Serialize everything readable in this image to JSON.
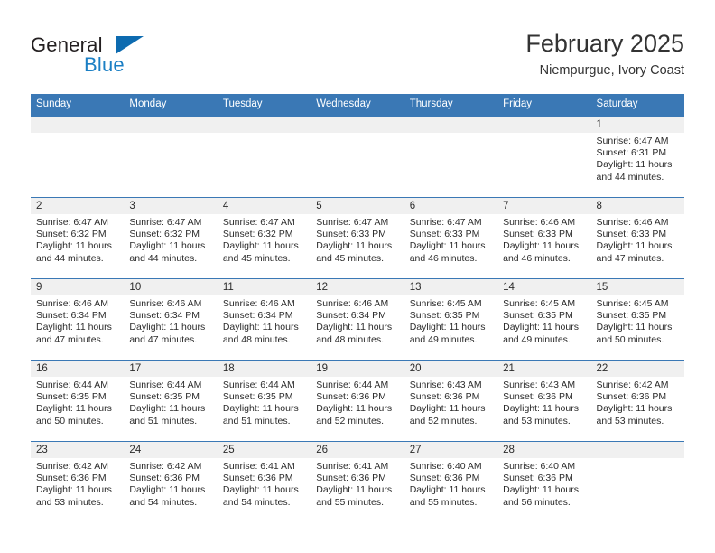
{
  "brand": {
    "name_part1": "General",
    "name_part2": "Blue",
    "triangle_icon": "triangle-icon",
    "accent_color": "#0d6bb0",
    "blue_text_color": "#1b7fc4"
  },
  "header": {
    "title": "February 2025",
    "subtitle": "Niempurgue, Ivory Coast"
  },
  "calendar": {
    "header_bg": "#3a78b5",
    "daynum_bg": "#f0f0f0",
    "weekday_headers": [
      "Sunday",
      "Monday",
      "Tuesday",
      "Wednesday",
      "Thursday",
      "Friday",
      "Saturday"
    ],
    "weeks": [
      [
        {
          "day": "",
          "sunrise": "",
          "sunset": "",
          "daylight_line1": "",
          "daylight_line2": "",
          "empty": true
        },
        {
          "day": "",
          "sunrise": "",
          "sunset": "",
          "daylight_line1": "",
          "daylight_line2": "",
          "empty": true
        },
        {
          "day": "",
          "sunrise": "",
          "sunset": "",
          "daylight_line1": "",
          "daylight_line2": "",
          "empty": true
        },
        {
          "day": "",
          "sunrise": "",
          "sunset": "",
          "daylight_line1": "",
          "daylight_line2": "",
          "empty": true
        },
        {
          "day": "",
          "sunrise": "",
          "sunset": "",
          "daylight_line1": "",
          "daylight_line2": "",
          "empty": true
        },
        {
          "day": "",
          "sunrise": "",
          "sunset": "",
          "daylight_line1": "",
          "daylight_line2": "",
          "empty": true
        },
        {
          "day": "1",
          "sunrise": "Sunrise: 6:47 AM",
          "sunset": "Sunset: 6:31 PM",
          "daylight_line1": "Daylight: 11 hours",
          "daylight_line2": "and 44 minutes.",
          "empty": false
        }
      ],
      [
        {
          "day": "2",
          "sunrise": "Sunrise: 6:47 AM",
          "sunset": "Sunset: 6:32 PM",
          "daylight_line1": "Daylight: 11 hours",
          "daylight_line2": "and 44 minutes.",
          "empty": false
        },
        {
          "day": "3",
          "sunrise": "Sunrise: 6:47 AM",
          "sunset": "Sunset: 6:32 PM",
          "daylight_line1": "Daylight: 11 hours",
          "daylight_line2": "and 44 minutes.",
          "empty": false
        },
        {
          "day": "4",
          "sunrise": "Sunrise: 6:47 AM",
          "sunset": "Sunset: 6:32 PM",
          "daylight_line1": "Daylight: 11 hours",
          "daylight_line2": "and 45 minutes.",
          "empty": false
        },
        {
          "day": "5",
          "sunrise": "Sunrise: 6:47 AM",
          "sunset": "Sunset: 6:33 PM",
          "daylight_line1": "Daylight: 11 hours",
          "daylight_line2": "and 45 minutes.",
          "empty": false
        },
        {
          "day": "6",
          "sunrise": "Sunrise: 6:47 AM",
          "sunset": "Sunset: 6:33 PM",
          "daylight_line1": "Daylight: 11 hours",
          "daylight_line2": "and 46 minutes.",
          "empty": false
        },
        {
          "day": "7",
          "sunrise": "Sunrise: 6:46 AM",
          "sunset": "Sunset: 6:33 PM",
          "daylight_line1": "Daylight: 11 hours",
          "daylight_line2": "and 46 minutes.",
          "empty": false
        },
        {
          "day": "8",
          "sunrise": "Sunrise: 6:46 AM",
          "sunset": "Sunset: 6:33 PM",
          "daylight_line1": "Daylight: 11 hours",
          "daylight_line2": "and 47 minutes.",
          "empty": false
        }
      ],
      [
        {
          "day": "9",
          "sunrise": "Sunrise: 6:46 AM",
          "sunset": "Sunset: 6:34 PM",
          "daylight_line1": "Daylight: 11 hours",
          "daylight_line2": "and 47 minutes.",
          "empty": false
        },
        {
          "day": "10",
          "sunrise": "Sunrise: 6:46 AM",
          "sunset": "Sunset: 6:34 PM",
          "daylight_line1": "Daylight: 11 hours",
          "daylight_line2": "and 47 minutes.",
          "empty": false
        },
        {
          "day": "11",
          "sunrise": "Sunrise: 6:46 AM",
          "sunset": "Sunset: 6:34 PM",
          "daylight_line1": "Daylight: 11 hours",
          "daylight_line2": "and 48 minutes.",
          "empty": false
        },
        {
          "day": "12",
          "sunrise": "Sunrise: 6:46 AM",
          "sunset": "Sunset: 6:34 PM",
          "daylight_line1": "Daylight: 11 hours",
          "daylight_line2": "and 48 minutes.",
          "empty": false
        },
        {
          "day": "13",
          "sunrise": "Sunrise: 6:45 AM",
          "sunset": "Sunset: 6:35 PM",
          "daylight_line1": "Daylight: 11 hours",
          "daylight_line2": "and 49 minutes.",
          "empty": false
        },
        {
          "day": "14",
          "sunrise": "Sunrise: 6:45 AM",
          "sunset": "Sunset: 6:35 PM",
          "daylight_line1": "Daylight: 11 hours",
          "daylight_line2": "and 49 minutes.",
          "empty": false
        },
        {
          "day": "15",
          "sunrise": "Sunrise: 6:45 AM",
          "sunset": "Sunset: 6:35 PM",
          "daylight_line1": "Daylight: 11 hours",
          "daylight_line2": "and 50 minutes.",
          "empty": false
        }
      ],
      [
        {
          "day": "16",
          "sunrise": "Sunrise: 6:44 AM",
          "sunset": "Sunset: 6:35 PM",
          "daylight_line1": "Daylight: 11 hours",
          "daylight_line2": "and 50 minutes.",
          "empty": false
        },
        {
          "day": "17",
          "sunrise": "Sunrise: 6:44 AM",
          "sunset": "Sunset: 6:35 PM",
          "daylight_line1": "Daylight: 11 hours",
          "daylight_line2": "and 51 minutes.",
          "empty": false
        },
        {
          "day": "18",
          "sunrise": "Sunrise: 6:44 AM",
          "sunset": "Sunset: 6:35 PM",
          "daylight_line1": "Daylight: 11 hours",
          "daylight_line2": "and 51 minutes.",
          "empty": false
        },
        {
          "day": "19",
          "sunrise": "Sunrise: 6:44 AM",
          "sunset": "Sunset: 6:36 PM",
          "daylight_line1": "Daylight: 11 hours",
          "daylight_line2": "and 52 minutes.",
          "empty": false
        },
        {
          "day": "20",
          "sunrise": "Sunrise: 6:43 AM",
          "sunset": "Sunset: 6:36 PM",
          "daylight_line1": "Daylight: 11 hours",
          "daylight_line2": "and 52 minutes.",
          "empty": false
        },
        {
          "day": "21",
          "sunrise": "Sunrise: 6:43 AM",
          "sunset": "Sunset: 6:36 PM",
          "daylight_line1": "Daylight: 11 hours",
          "daylight_line2": "and 53 minutes.",
          "empty": false
        },
        {
          "day": "22",
          "sunrise": "Sunrise: 6:42 AM",
          "sunset": "Sunset: 6:36 PM",
          "daylight_line1": "Daylight: 11 hours",
          "daylight_line2": "and 53 minutes.",
          "empty": false
        }
      ],
      [
        {
          "day": "23",
          "sunrise": "Sunrise: 6:42 AM",
          "sunset": "Sunset: 6:36 PM",
          "daylight_line1": "Daylight: 11 hours",
          "daylight_line2": "and 53 minutes.",
          "empty": false
        },
        {
          "day": "24",
          "sunrise": "Sunrise: 6:42 AM",
          "sunset": "Sunset: 6:36 PM",
          "daylight_line1": "Daylight: 11 hours",
          "daylight_line2": "and 54 minutes.",
          "empty": false
        },
        {
          "day": "25",
          "sunrise": "Sunrise: 6:41 AM",
          "sunset": "Sunset: 6:36 PM",
          "daylight_line1": "Daylight: 11 hours",
          "daylight_line2": "and 54 minutes.",
          "empty": false
        },
        {
          "day": "26",
          "sunrise": "Sunrise: 6:41 AM",
          "sunset": "Sunset: 6:36 PM",
          "daylight_line1": "Daylight: 11 hours",
          "daylight_line2": "and 55 minutes.",
          "empty": false
        },
        {
          "day": "27",
          "sunrise": "Sunrise: 6:40 AM",
          "sunset": "Sunset: 6:36 PM",
          "daylight_line1": "Daylight: 11 hours",
          "daylight_line2": "and 55 minutes.",
          "empty": false
        },
        {
          "day": "28",
          "sunrise": "Sunrise: 6:40 AM",
          "sunset": "Sunset: 6:36 PM",
          "daylight_line1": "Daylight: 11 hours",
          "daylight_line2": "and 56 minutes.",
          "empty": false
        },
        {
          "day": "",
          "sunrise": "",
          "sunset": "",
          "daylight_line1": "",
          "daylight_line2": "",
          "empty": true
        }
      ]
    ]
  }
}
